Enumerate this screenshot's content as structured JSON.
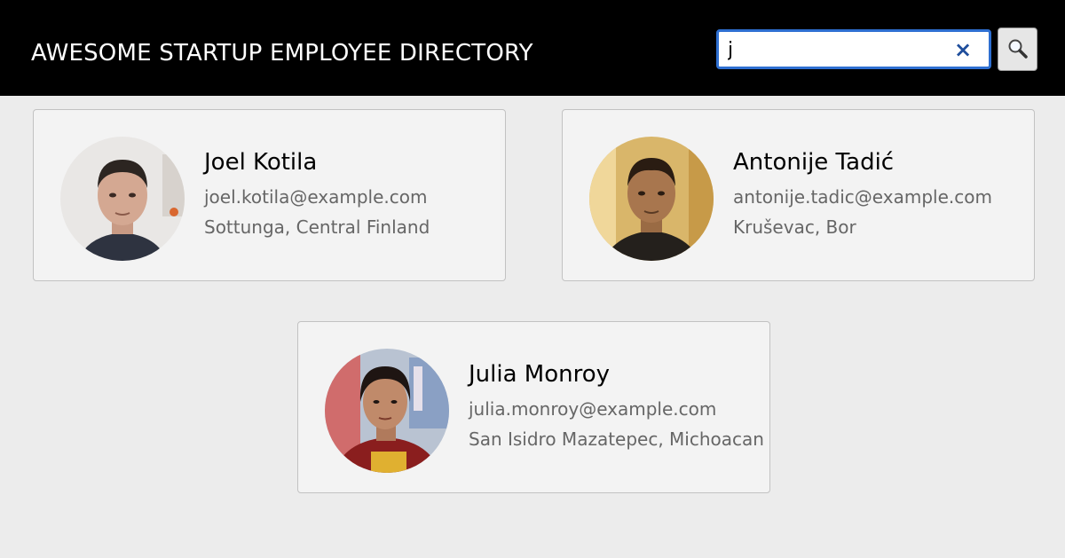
{
  "header": {
    "title": "AWESOME STARTUP EMPLOYEE DIRECTORY"
  },
  "search": {
    "value": "j",
    "clear_icon": "×",
    "clear_icon_name": "close-icon",
    "button_icon_name": "search-icon"
  },
  "colors": {
    "header_bg": "#000000",
    "page_bg": "#ececec",
    "card_bg": "#f3f3f3",
    "search_border": "#2e6fd1",
    "clear_icon": "#1f4e9c",
    "secondary_text": "#666666"
  },
  "employees": [
    {
      "name": "Joel Kotila",
      "email": "joel.kotila@example.com",
      "location": "Sottunga, Central Finland"
    },
    {
      "name": "Antonije Tadić",
      "email": "antonije.tadic@example.com",
      "location": "Kruševac, Bor"
    },
    {
      "name": "Julia Monroy",
      "email": "julia.monroy@example.com",
      "location": "San Isidro Mazatepec, Michoacan"
    }
  ]
}
